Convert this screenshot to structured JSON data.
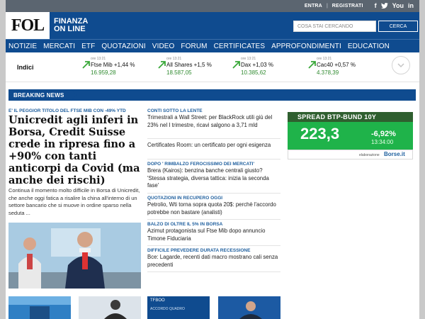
{
  "topbar": {
    "login": "ENTRA",
    "separator": "|",
    "register": "REGISTRATI",
    "social": [
      "f",
      "t",
      "You",
      "in"
    ]
  },
  "header": {
    "logo": "FOL",
    "logo_text_line1": "FINANZA",
    "logo_text_line2": "ON LINE",
    "search_placeholder": "COSA STAI CERCANDO",
    "search_button": "CERCA"
  },
  "nav": [
    "NOTIZIE",
    "MERCATI",
    "ETF",
    "QUOTAZIONI",
    "VIDEO",
    "FORUM",
    "CERTIFICATES",
    "APPROFONDIMENTI",
    "EDUCATION"
  ],
  "indices": {
    "label": "Indici",
    "items": [
      {
        "time": "ore 13:21",
        "name": "Ftse Mib +1,44 %",
        "value": "16.959,28"
      },
      {
        "time": "ore 13:21",
        "name": "All Shares +1,5 %",
        "value": "18.587,05"
      },
      {
        "time": "ore 13:21",
        "name": "Dax +1,03 %",
        "value": "10.385,62"
      },
      {
        "time": "ore 13:21",
        "name": "Cac40 +0,57 %",
        "value": "4.378,39"
      }
    ],
    "accent": "#2f8a2f"
  },
  "breaking": "BREAKING NEWS",
  "main": {
    "kicker": "E' IL PEGGIOR TITOLO DEL FTSE MIB CON -49% YTD",
    "headline": "Unicredit agli inferi in Borsa, Credit Suisse crede in ripresa fino a +90% con tanti anticorpi da Covid (ma anche dei rischi)",
    "summary": "Continua il momento molto difficile in Borsa di Unicredit, che anche oggi fatica a risalire la china all'interno di un settore bancario che si muove in ordine sparso nella seduta ..."
  },
  "middle": [
    {
      "kicker": "CONTI SOTTO LA LENTE",
      "text": "Trimestrali a Wall Street: per BlackRock utili giù del 23% nel I trimestre, ricavi salgono a 3,71 mld"
    },
    {
      "kicker": "",
      "text": "Certificates Room: un certificato per ogni esigenza"
    },
    {
      "kicker": "DOPO ' RIMBALZO FEROCISSIMO DEI MERCATI'",
      "text": "Brera (Kairos): benzina banche centrali giusto? 'Stessa strategia, diversa tattica: inizia la seconda fase'"
    },
    {
      "kicker": "QUOTAZIONI IN RECUPERO OGGI",
      "text": "Petrolio, Wti torna sopra quota 20$: perchè l'accordo potrebbe non bastare (analisti)"
    },
    {
      "kicker": "BALZO DI OLTRE IL 5% IN BORSA",
      "text": "Azimut protagonista sul Ftse Mib dopo annuncio Timone Fiduciaria"
    },
    {
      "kicker": "DIFFICILE PREVEDERE DURATA RECESSIONE",
      "text": "Bce: Lagarde, recenti dati macro mostrano cali senza precedenti"
    }
  ],
  "spread": {
    "title": "SPREAD BTP-BUND 10Y",
    "value": "223,3",
    "change": "-6,92%",
    "time": "13:34:00",
    "credit": "elaborazione",
    "brand": "Borse.it"
  },
  "thumb_text": "TFBOO",
  "thumb_text2": "ACCORDO QUADRO"
}
